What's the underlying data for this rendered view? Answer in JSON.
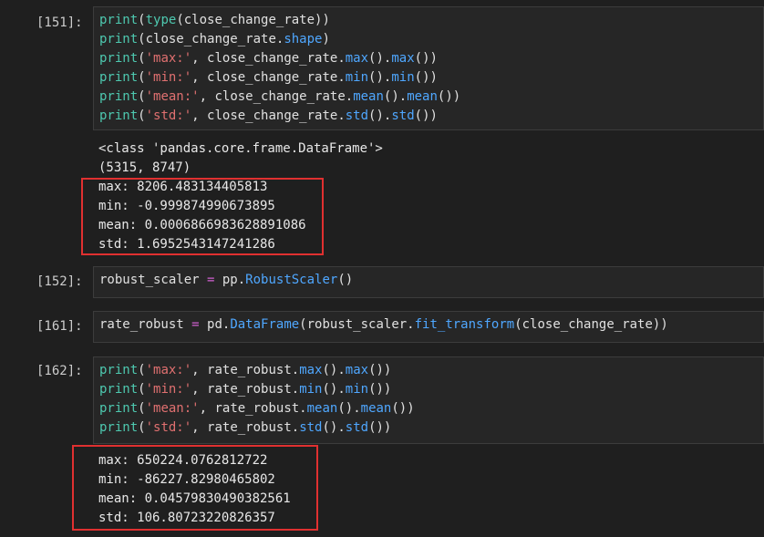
{
  "cells": [
    {
      "prompt": "[151]:",
      "code": [
        [
          [
            "print",
            "fn"
          ],
          [
            "(",
            "plain"
          ],
          [
            "type",
            "fn"
          ],
          [
            "(close_change_rate))",
            "plain"
          ]
        ],
        [
          [
            "print",
            "fn"
          ],
          [
            "(close_change_rate.",
            "plain"
          ],
          [
            "shape",
            "attr"
          ],
          [
            ")",
            "plain"
          ]
        ],
        [
          [
            "print",
            "fn"
          ],
          [
            "(",
            "plain"
          ],
          [
            "'max:'",
            "str"
          ],
          [
            ", close_change_rate.",
            "plain"
          ],
          [
            "max",
            "attr"
          ],
          [
            "().",
            "plain"
          ],
          [
            "max",
            "attr"
          ],
          [
            "())",
            "plain"
          ]
        ],
        [
          [
            "print",
            "fn"
          ],
          [
            "(",
            "plain"
          ],
          [
            "'min:'",
            "str"
          ],
          [
            ", close_change_rate.",
            "plain"
          ],
          [
            "min",
            "attr"
          ],
          [
            "().",
            "plain"
          ],
          [
            "min",
            "attr"
          ],
          [
            "())",
            "plain"
          ]
        ],
        [
          [
            "print",
            "fn"
          ],
          [
            "(",
            "plain"
          ],
          [
            "'mean:'",
            "str"
          ],
          [
            ", close_change_rate.",
            "plain"
          ],
          [
            "mean",
            "attr"
          ],
          [
            "().",
            "plain"
          ],
          [
            "mean",
            "attr"
          ],
          [
            "())",
            "plain"
          ]
        ],
        [
          [
            "print",
            "fn"
          ],
          [
            "(",
            "plain"
          ],
          [
            "'std:'",
            "str"
          ],
          [
            ", close_change_rate.",
            "plain"
          ],
          [
            "std",
            "attr"
          ],
          [
            "().",
            "plain"
          ],
          [
            "std",
            "attr"
          ],
          [
            "())",
            "plain"
          ]
        ]
      ],
      "output": [
        "<class 'pandas.core.frame.DataFrame'>",
        "(5315, 8747)",
        "max: 8206.483134405813",
        "min: -0.999874990673895",
        "mean: 0.0006866983628891086",
        "std: 1.6952543147241286"
      ]
    },
    {
      "prompt": "[152]:",
      "code": [
        [
          [
            "robust_scaler ",
            "plain"
          ],
          [
            "=",
            "op"
          ],
          [
            " pp.",
            "plain"
          ],
          [
            "RobustScaler",
            "attr"
          ],
          [
            "()",
            "plain"
          ]
        ]
      ],
      "output": []
    },
    {
      "prompt": "[161]:",
      "code": [
        [
          [
            "rate_robust ",
            "plain"
          ],
          [
            "=",
            "op"
          ],
          [
            " pd.",
            "plain"
          ],
          [
            "DataFrame",
            "attr"
          ],
          [
            "(robust_scaler.",
            "plain"
          ],
          [
            "fit_transform",
            "attr"
          ],
          [
            "(close_change_rate))",
            "plain"
          ]
        ]
      ],
      "output": []
    },
    {
      "prompt": "[162]:",
      "code": [
        [
          [
            "print",
            "fn"
          ],
          [
            "(",
            "plain"
          ],
          [
            "'max:'",
            "str"
          ],
          [
            ", rate_robust.",
            "plain"
          ],
          [
            "max",
            "attr"
          ],
          [
            "().",
            "plain"
          ],
          [
            "max",
            "attr"
          ],
          [
            "())",
            "plain"
          ]
        ],
        [
          [
            "print",
            "fn"
          ],
          [
            "(",
            "plain"
          ],
          [
            "'min:'",
            "str"
          ],
          [
            ", rate_robust.",
            "plain"
          ],
          [
            "min",
            "attr"
          ],
          [
            "().",
            "plain"
          ],
          [
            "min",
            "attr"
          ],
          [
            "())",
            "plain"
          ]
        ],
        [
          [
            "print",
            "fn"
          ],
          [
            "(",
            "plain"
          ],
          [
            "'mean:'",
            "str"
          ],
          [
            ", rate_robust.",
            "plain"
          ],
          [
            "mean",
            "attr"
          ],
          [
            "().",
            "plain"
          ],
          [
            "mean",
            "attr"
          ],
          [
            "())",
            "plain"
          ]
        ],
        [
          [
            "print",
            "fn"
          ],
          [
            "(",
            "plain"
          ],
          [
            "'std:'",
            "str"
          ],
          [
            ", rate_robust.",
            "plain"
          ],
          [
            "std",
            "attr"
          ],
          [
            "().",
            "plain"
          ],
          [
            "std",
            "attr"
          ],
          [
            "())",
            "plain"
          ]
        ]
      ],
      "output": [
        "max: 650224.0762812722",
        "min: -86227.82980465802",
        "mean: 0.04579830490382561",
        "std: 106.80723220826357"
      ]
    }
  ],
  "colors": {
    "background": "#1f1f1f",
    "editor_bg": "#262626",
    "function": "#4ec9b0",
    "attribute": "#4fa7ff",
    "string": "#e07070",
    "operator": "#d060d0",
    "highlight_box": "#e03030"
  }
}
